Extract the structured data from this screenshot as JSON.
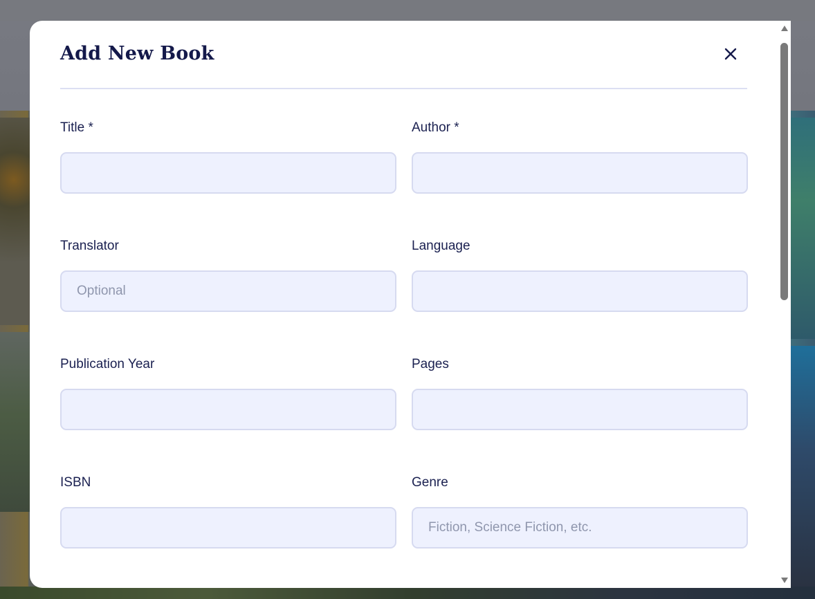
{
  "dialog": {
    "title": "Add New Book",
    "close_icon": "close-icon"
  },
  "fields": {
    "title": {
      "label": "Title *",
      "value": "",
      "placeholder": ""
    },
    "author": {
      "label": "Author *",
      "value": "",
      "placeholder": ""
    },
    "translator": {
      "label": "Translator",
      "value": "",
      "placeholder": "Optional"
    },
    "language": {
      "label": "Language",
      "value": "",
      "placeholder": ""
    },
    "publication_year": {
      "label": "Publication Year",
      "value": "",
      "placeholder": ""
    },
    "pages": {
      "label": "Pages",
      "value": "",
      "placeholder": ""
    },
    "isbn": {
      "label": "ISBN",
      "value": "",
      "placeholder": ""
    },
    "genre": {
      "label": "Genre",
      "value": "",
      "placeholder": "Fiction, Science Fiction, etc."
    }
  },
  "colors": {
    "title_text": "#14194a",
    "input_background": "#eef1fe",
    "input_border": "#d6daf0",
    "divider": "#dcdff3"
  }
}
